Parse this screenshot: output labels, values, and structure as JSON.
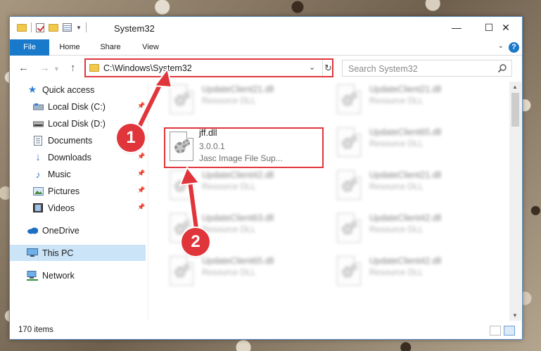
{
  "window": {
    "title": "System32",
    "controls": {
      "minimize": "—",
      "maximize": "☐",
      "close": "✕"
    }
  },
  "ribbon": {
    "tabs": [
      {
        "label": "File"
      },
      {
        "label": "Home"
      },
      {
        "label": "Share"
      },
      {
        "label": "View"
      }
    ],
    "help": "?"
  },
  "nav": {
    "back": "←",
    "forward": "→",
    "up": "↑",
    "address": "C:\\Windows\\System32",
    "refresh": "↻",
    "search_placeholder": "Search System32"
  },
  "sidebar": {
    "items": [
      {
        "label": "Quick access",
        "icon": "star-icon",
        "pinned": false
      },
      {
        "label": "Local Disk (C:)",
        "icon": "drive-icon",
        "pinned": true
      },
      {
        "label": "Local Disk (D:)",
        "icon": "drive-icon",
        "pinned": false
      },
      {
        "label": "Documents",
        "icon": "documents-icon",
        "pinned": true
      },
      {
        "label": "Downloads",
        "icon": "download-icon",
        "pinned": true
      },
      {
        "label": "Music",
        "icon": "music-icon",
        "pinned": true
      },
      {
        "label": "Pictures",
        "icon": "pictures-icon",
        "pinned": true
      },
      {
        "label": "Videos",
        "icon": "videos-icon",
        "pinned": true
      },
      {
        "label": "OneDrive",
        "icon": "cloud-icon",
        "pinned": false
      },
      {
        "label": "This PC",
        "icon": "computer-icon",
        "pinned": false,
        "selected": true
      },
      {
        "label": "Network",
        "icon": "network-icon",
        "pinned": false
      }
    ]
  },
  "files": {
    "left": [
      {
        "name": "UpdateClient21.dll",
        "sub": "Resource DLL"
      },
      {
        "name": "jff.dll",
        "version": "3.0.0.1",
        "desc": "Jasc Image File Sup..."
      },
      {
        "name": "UpdateClient42.dll",
        "sub": "Resource DLL"
      },
      {
        "name": "UpdateClient63.dll",
        "sub": "Resource DLL"
      },
      {
        "name": "UpdateClient65.dll",
        "sub": "Resource DLL"
      }
    ],
    "right": [
      {
        "name": "UpdateClient21.dll",
        "sub": "Resource DLL"
      },
      {
        "name": "UpdateClient65.dll",
        "sub": "Resource DLL"
      },
      {
        "name": "UpdateClient21.dll",
        "sub": "Resource DLL"
      },
      {
        "name": "UpdateClient42.dll",
        "sub": "Resource DLL"
      },
      {
        "name": "UpdateClient42.dll",
        "sub": "Resource DLL"
      }
    ]
  },
  "status": {
    "count": "170 items"
  },
  "annotations": {
    "step1": "1",
    "step2": "2",
    "color": "#e0353b"
  }
}
